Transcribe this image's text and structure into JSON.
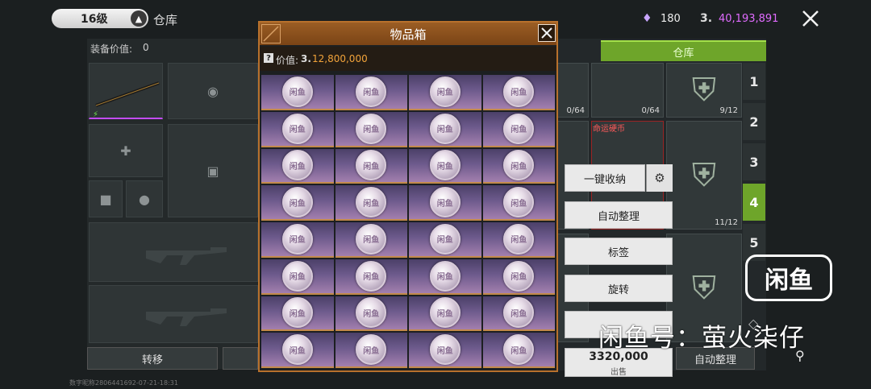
{
  "topbar": {
    "level": "16级",
    "title": "仓库",
    "gems": "180",
    "coins": "40,193,891",
    "coin_symbol": "3."
  },
  "equipment": {
    "value_label": "装备价值:",
    "value": "0",
    "transfer_label": "转移"
  },
  "warehouse": {
    "tab_label": "仓库",
    "items": [
      {
        "count": "0/64"
      },
      {
        "count": "0/64"
      },
      {
        "count": "9/12"
      },
      {
        "count": ""
      },
      {
        "label": "命运硬币"
      },
      {
        "count": "11/12"
      }
    ],
    "pages": [
      "1",
      "2",
      "3",
      "4",
      "5"
    ],
    "active_page": "4",
    "buttons": {
      "quick_store": "一键收纳",
      "auto_sort": "自动整理",
      "tag": "标签",
      "rotate": "旋转",
      "sell_price": "3320,000",
      "sell_label": "出售",
      "auto_sort_bottom": "自动整理"
    }
  },
  "modal": {
    "title": "物品箱",
    "value_label": "价值:",
    "value_coin_symbol": "3.",
    "value_amount": "12,800,000",
    "coin_glyph": "闲鱼",
    "grid_rows": 8,
    "grid_cols": 4
  },
  "footer": {
    "id_text": "数字昵称2806441692-07-21-18:31"
  },
  "watermark": {
    "logo": "闲鱼",
    "text": "闲鱼号：萤火柒仔"
  }
}
